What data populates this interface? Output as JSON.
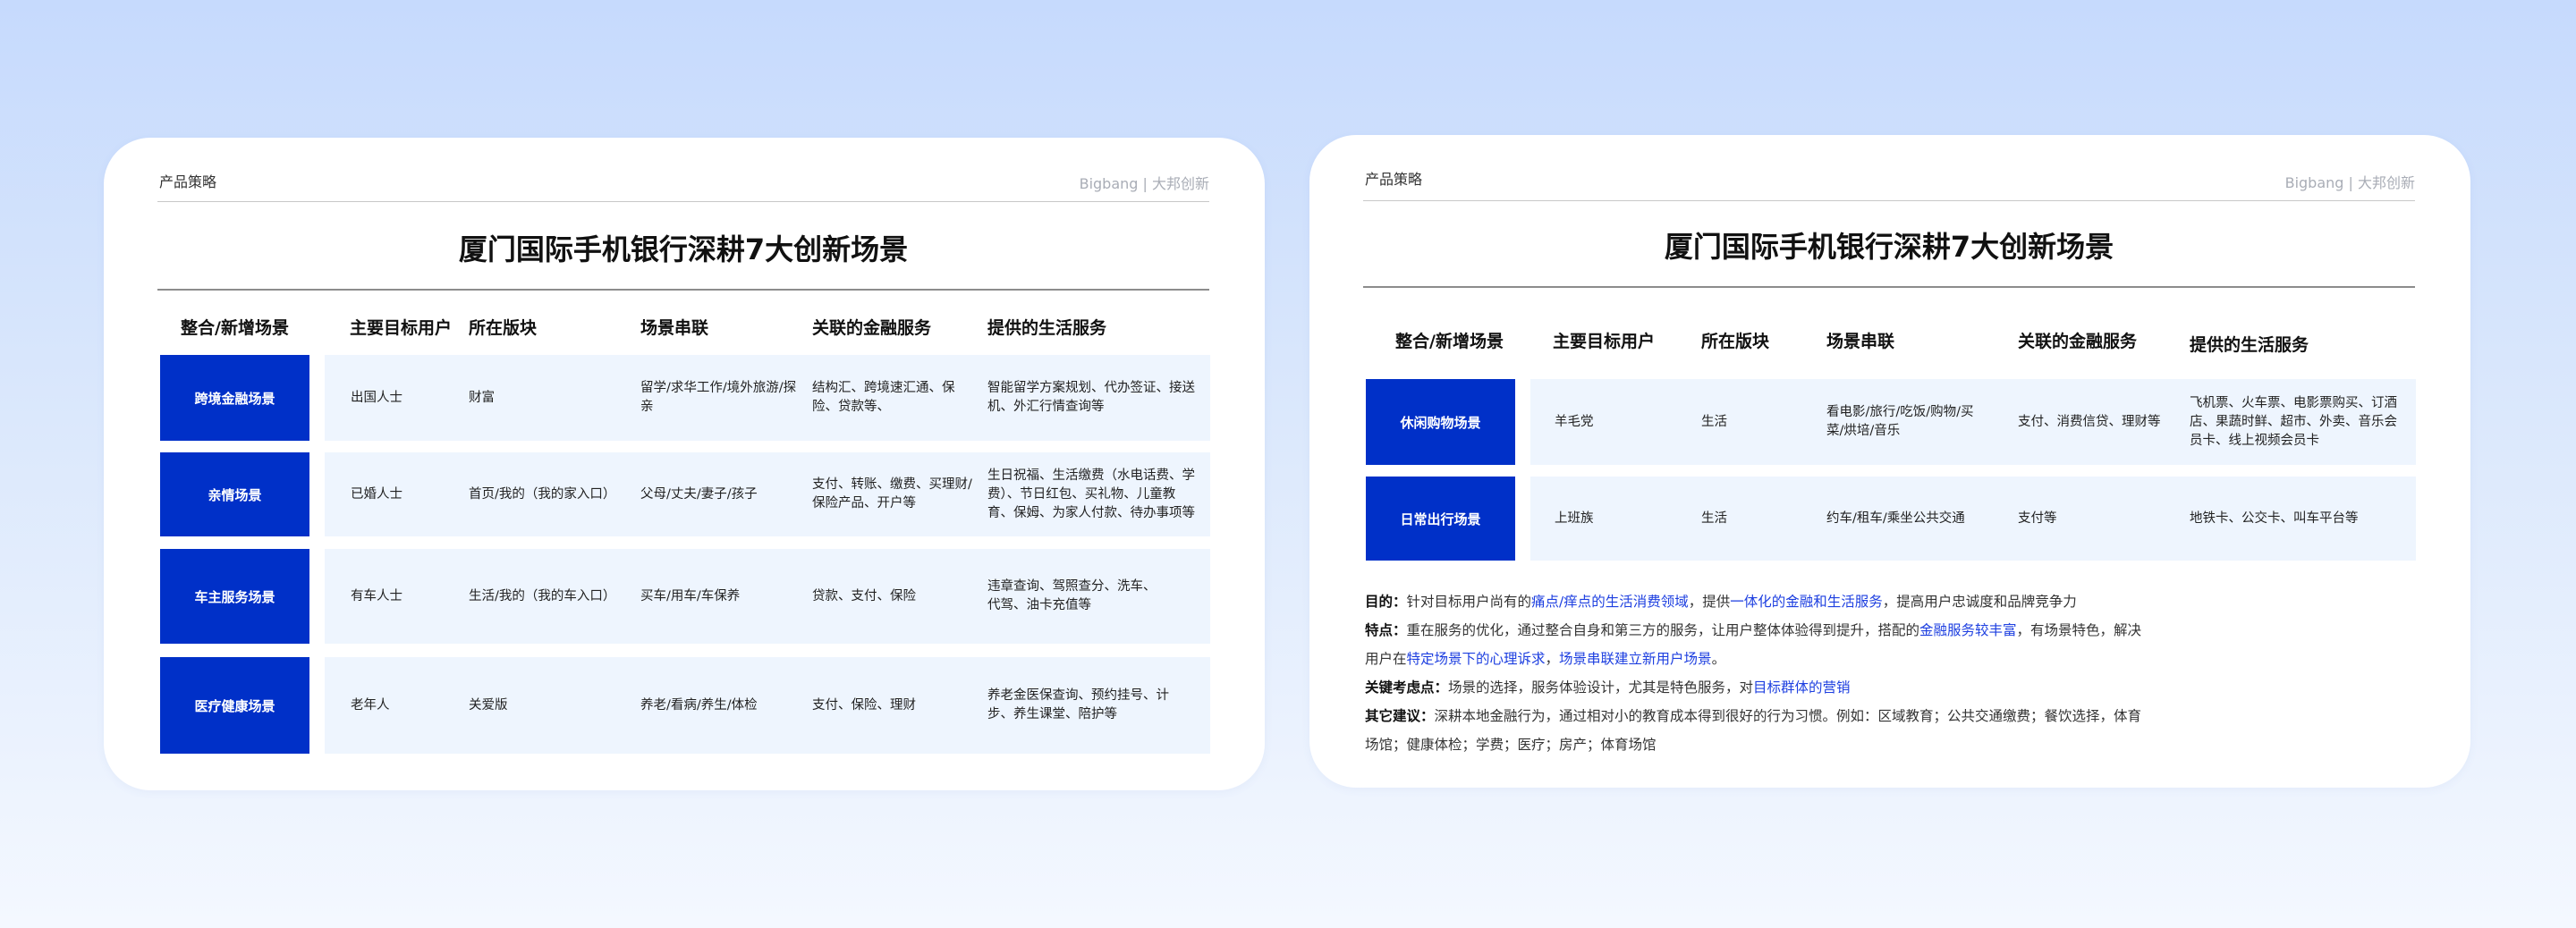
{
  "left": {
    "header_left": "产品策略",
    "header_right": "Bigbang | 大邦创新",
    "title": "厦门国际手机银行深耕7大创新场景",
    "columns": [
      "整合/新增场景",
      "主要目标用户",
      "所在版块",
      "场景串联",
      "关联的金融服务",
      "提供的生活服务"
    ],
    "rows": [
      {
        "scene": "跨境金融场景",
        "user": "出国人士",
        "section": "财富",
        "chain": "留学/求华工作/境外旅游/探亲",
        "finance": "结构汇、跨境速汇通、保险、贷款等、",
        "life": "智能留学方案规划、代办签证、接送机、外汇行情查询等"
      },
      {
        "scene": "亲情场景",
        "user": "已婚人士",
        "section": "首页/我的（我的家入口）",
        "chain": "父母/丈夫/妻子/孩子",
        "finance": "支付、转账、缴费、买理财/保险产品、开户等",
        "life": "生日祝福、生活缴费（水电话费、学费）、节日红包、买礼物、儿童教育、保姆、为家人付款、待办事项等"
      },
      {
        "scene": "车主服务场景",
        "user": "有车人士",
        "section": "生活/我的（我的车入口）",
        "chain": "买车/用车/车保养",
        "finance": "贷款、支付、保险",
        "life": "违章查询、驾照查分、洗车、代驾、油卡充值等"
      },
      {
        "scene": "医疗健康场景",
        "user": "老年人",
        "section": "关爱版",
        "chain": "养老/看病/养生/体检",
        "finance": "支付、保险、理财",
        "life": "养老金医保查询、预约挂号、计步、养生课堂、陪护等"
      }
    ]
  },
  "right": {
    "header_left": "产品策略",
    "header_right": "Bigbang | 大邦创新",
    "title": "厦门国际手机银行深耕7大创新场景",
    "columns": [
      "整合/新增场景",
      "主要目标用户",
      "所在版块",
      "场景串联",
      "关联的金融服务",
      "提供的生活服务"
    ],
    "rows": [
      {
        "scene": "休闲购物场景",
        "user": "羊毛党",
        "section": "生活",
        "chain": "看电影/旅行/吃饭/购物/买菜/烘培/音乐",
        "finance": "支付、消费信贷、理财等",
        "life": "飞机票、火车票、电影票购买、订酒店、果蔬时鲜、超市、外卖、音乐会员卡、线上视频会员卡"
      },
      {
        "scene": "日常出行场景",
        "user": "上班族",
        "section": "生活",
        "chain": "约车/租车/乘坐公共交通",
        "finance": "支付等",
        "life": "地铁卡、公交卡、叫车平台等"
      }
    ],
    "notes": {
      "purpose": {
        "label": "目的：",
        "t1": "针对目标用户尚有的",
        "h1": "痛点/痒点的生活消费领域",
        "t2": "，提供",
        "h2": "一体化的金融和生活服务",
        "t3": "，提高用户忠诚度和品牌竞争力"
      },
      "feature": {
        "label": "特点：",
        "t1": "重在服务的优化，通过整合自身和第三方的服务，让用户整体体验得到提升，搭配的",
        "h1": "金融服务较丰富",
        "t2": "，有场景特色，解决用户在",
        "h2": "特定场景下的心理诉求",
        "t3": "，",
        "h3": "场景串联建立新用户场景",
        "t4": "。"
      },
      "key": {
        "label": "关键考虑点：",
        "t1": "场景的选择，服务体验设计，尤其是特色服务，对",
        "h1": "目标群体的营销"
      },
      "other": {
        "label": "其它建议：",
        "t1": "深耕本地金融行为，通过相对小的教育成本得到很好的行为习惯。例如：区域教育；公共交通缴费；餐饮选择，体育场馆；健康体检；学费；医疗；房产；体育场馆"
      }
    }
  }
}
